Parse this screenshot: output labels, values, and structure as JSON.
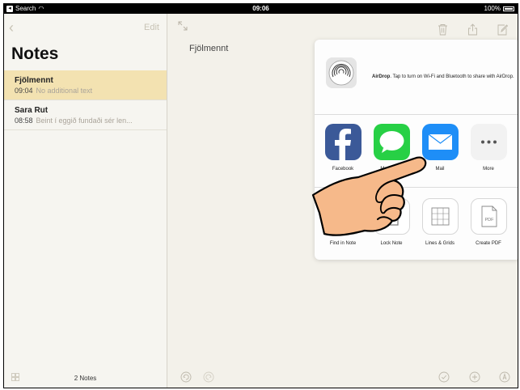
{
  "status": {
    "back_app": "Search",
    "time": "09:06",
    "battery": "100%"
  },
  "sidebar": {
    "edit_label": "Edit",
    "title": "Notes",
    "notes": [
      {
        "title": "Fjölmennt",
        "time": "09:04",
        "preview": "No additional text",
        "selected": true
      },
      {
        "title": "Sara Rut",
        "time": "08:58",
        "preview": "Beint í eggið fundaði sér len...",
        "selected": false
      }
    ],
    "count_label": "2 Notes"
  },
  "detail": {
    "note_title": "Fjölmennt"
  },
  "share_sheet": {
    "airdrop_bold": "AirDrop",
    "airdrop_text": ". Tap to turn on Wi-Fi and Bluetooth to share with AirDrop.",
    "apps": [
      {
        "label": "Facebook",
        "icon": "facebook-icon"
      },
      {
        "label": "Messages",
        "icon": "messages-icon"
      },
      {
        "label": "Mail",
        "icon": "mail-icon"
      },
      {
        "label": "More",
        "icon": "more-icon"
      }
    ],
    "actions": [
      {
        "label": "Find in Note",
        "icon": "search-icon"
      },
      {
        "label": "Lock Note",
        "icon": "lock-icon"
      },
      {
        "label": "Lines & Grids",
        "icon": "grid-icon"
      },
      {
        "label": "Create PDF",
        "icon": "pdf-icon"
      }
    ],
    "pdf_badge": "PDF"
  },
  "colors": {
    "accent": "#c8c3b5",
    "selected_row": "#f3e2b1",
    "mail_blue": "#1e8ef7",
    "facebook_blue": "#3b5998",
    "messages_green": "#27d045"
  }
}
